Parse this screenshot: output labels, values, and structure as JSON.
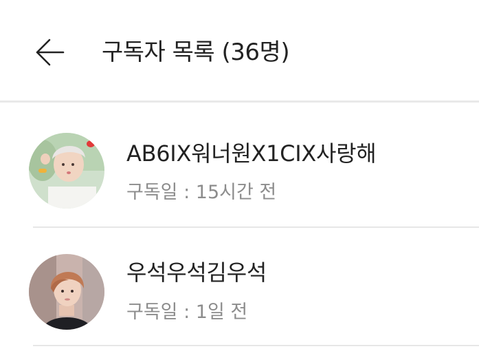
{
  "header": {
    "back_icon": "arrow-left-icon",
    "title": "구독자 목록 (36명)"
  },
  "subscribers": [
    {
      "name": "AB6IX워너원X1CIX사랑해",
      "subscribed_label": "구독일 : 15시간 전"
    },
    {
      "name": "우석우석김우석",
      "subscribed_label": "구독일 : 1일 전"
    }
  ]
}
